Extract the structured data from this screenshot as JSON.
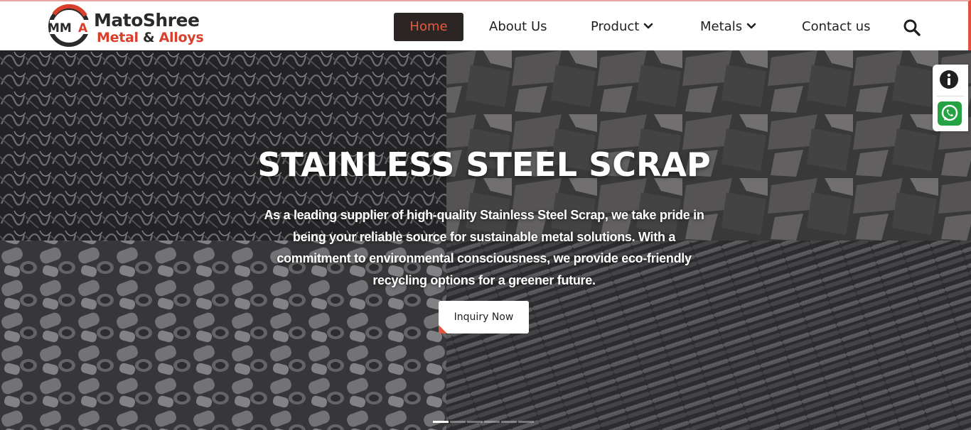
{
  "brand": {
    "mark_text": "MMA",
    "name_line1": "MatoShree",
    "name_line2_a": "Metal",
    "name_line2_amp": "&",
    "name_line2_b": "Alloys"
  },
  "nav": {
    "home": "Home",
    "about": "About Us",
    "product": "Product",
    "metals": "Metals",
    "contact": "Contact us"
  },
  "hero": {
    "title": "STAINLESS STEEL SCRAP",
    "description": "As a leading supplier of high-quality Stainless Steel Scrap, we take pride in being your reliable source for sustainable metal solutions. With a commitment to environmental consciousness, we provide eco-friendly recycling options for a greener future.",
    "cta": "Inquiry Now",
    "slides_total": 6,
    "active_slide": 1
  },
  "icons": {
    "search": "search-icon",
    "info": "info-icon",
    "whatsapp": "whatsapp-icon",
    "chevron": "chevron-down-icon"
  },
  "colors": {
    "accent": "#e0533e",
    "nav_active_bg": "#2b2523",
    "whatsapp": "#25a244"
  }
}
